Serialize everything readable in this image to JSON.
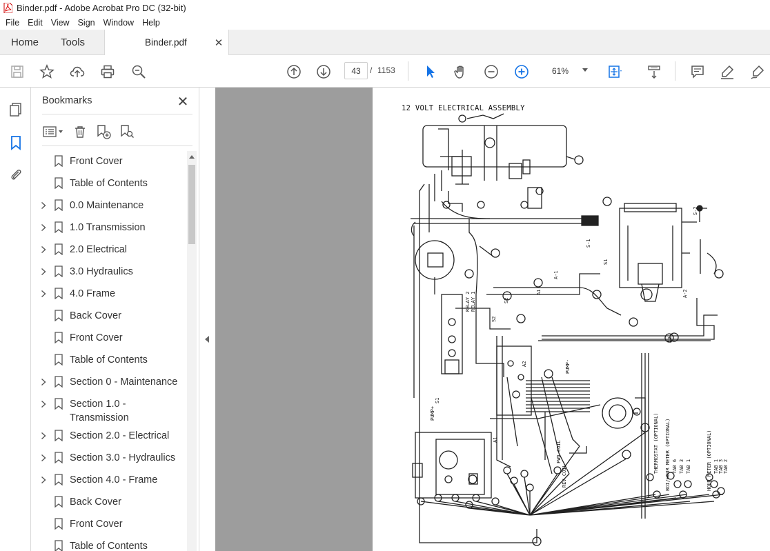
{
  "window": {
    "title": "Binder.pdf - Adobe Acrobat Pro DC (32-bit)"
  },
  "menu": [
    "File",
    "Edit",
    "View",
    "Sign",
    "Window",
    "Help"
  ],
  "tabs": {
    "home": "Home",
    "tools": "Tools",
    "document": "Binder.pdf"
  },
  "toolbar": {
    "current_page": "43",
    "page_separator": "/",
    "page_count": "1153",
    "zoom": "61%"
  },
  "bookmarks": {
    "title": "Bookmarks",
    "items": [
      {
        "label": "Front Cover",
        "expandable": false
      },
      {
        "label": "Table of Contents",
        "expandable": false
      },
      {
        "label": "0.0 Maintenance",
        "expandable": true
      },
      {
        "label": "1.0 Transmission",
        "expandable": true
      },
      {
        "label": "2.0 Electrical",
        "expandable": true
      },
      {
        "label": "3.0 Hydraulics",
        "expandable": true
      },
      {
        "label": "4.0 Frame",
        "expandable": true
      },
      {
        "label": "Back Cover",
        "expandable": false
      },
      {
        "label": "Front Cover",
        "expandable": false
      },
      {
        "label": "Table of Contents",
        "expandable": false
      },
      {
        "label": "Section 0 - Maintenance",
        "expandable": true
      },
      {
        "label": "Section 1.0 -",
        "label2": "Transmission",
        "expandable": true
      },
      {
        "label": "Section 2.0 - Electrical",
        "expandable": true
      },
      {
        "label": "Section 3.0 - Hydraulics",
        "expandable": true
      },
      {
        "label": "Section 4.0 - Frame",
        "expandable": true
      },
      {
        "label": "Back Cover",
        "expandable": false
      },
      {
        "label": "Front Cover",
        "expandable": false
      },
      {
        "label": "Table of Contents",
        "expandable": false
      }
    ]
  },
  "document": {
    "page_title": "12 VOLT ELECTRICAL ASSEMBLY",
    "labels": {
      "s2_top": "S-2",
      "s1": "S-1",
      "a1_top": "A-1",
      "a2_right": "A-2",
      "relay1": "RELAY 1",
      "relay2": "RELAY 2",
      "s2_mid": "S2",
      "pump_plus": "PUMP+",
      "pump_minus": "PUMP-",
      "s1_low": "S1",
      "a1_low": "A1",
      "a2_mid": "A2",
      "s1_node": "S1",
      "s2_node": "S2",
      "a1_node": "A1",
      "a2_node": "A2",
      "thermostat": "THERMOSTAT (OPTIONAL)",
      "boi_hour_meter": "BOI/HOUR METER (OPTIONAL)",
      "hour_meter": "HOUR METER (OPTIONAL)",
      "tab6": "TAB 6",
      "tab3": "TAB 3",
      "tab1": "TAB 1",
      "tab1b": "TAB 1",
      "tab3b": "TAB 3",
      "tab2b": "TAB 2",
      "fwd_coil": "FWD COIL",
      "rev_coil": "REV COIL"
    }
  },
  "colors": {
    "accent_blue": "#1473e6",
    "tab_bg": "#f0f0f0",
    "viewer_bg": "#9d9d9d"
  }
}
